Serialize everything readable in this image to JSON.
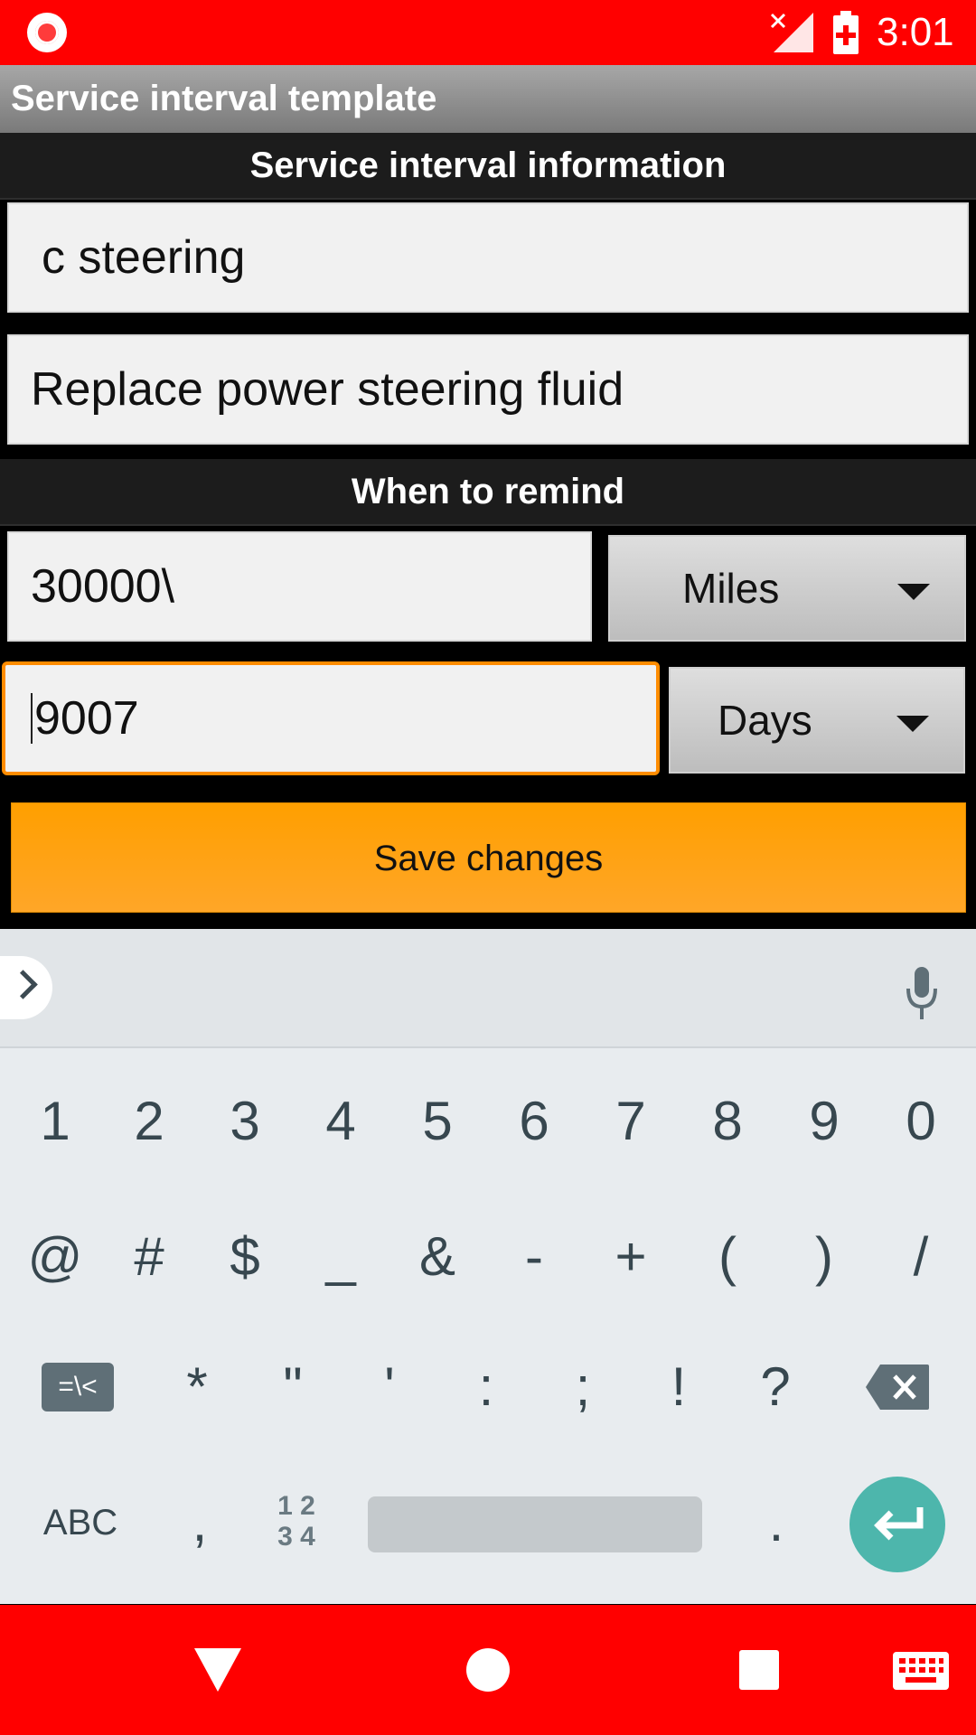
{
  "status_bar": {
    "time": "3:01",
    "icons": [
      "record-icon",
      "no-signal-icon",
      "battery-charging-icon"
    ]
  },
  "app_bar": {
    "title": "Service interval template"
  },
  "sections": {
    "info": "Service interval information",
    "remind": "When to remind"
  },
  "fields": {
    "category": "c steering",
    "description": "Replace power steering fluid",
    "distance_value": "30000\\",
    "time_value": "9007"
  },
  "spinners": {
    "distance_unit": "Miles",
    "time_unit": "Days"
  },
  "buttons": {
    "save": "Save changes"
  },
  "keyboard": {
    "row1": [
      "1",
      "2",
      "3",
      "4",
      "5",
      "6",
      "7",
      "8",
      "9",
      "0"
    ],
    "row2": [
      "@",
      "#",
      "$",
      "_",
      "&",
      "-",
      "+",
      "(",
      ")",
      "/"
    ],
    "row3": [
      "*",
      "\"",
      "'",
      ":",
      ";",
      "!",
      "?"
    ],
    "sym_key": "=\\<",
    "abc_key": "ABC",
    "comma": ",",
    "period": ".",
    "numpad_top": "1 2",
    "numpad_bottom": "3 4"
  },
  "colors": {
    "status_bar": "#ff0000",
    "accent": "#ffa000",
    "focus": "#ff8c00",
    "enter": "#4db6ac"
  }
}
